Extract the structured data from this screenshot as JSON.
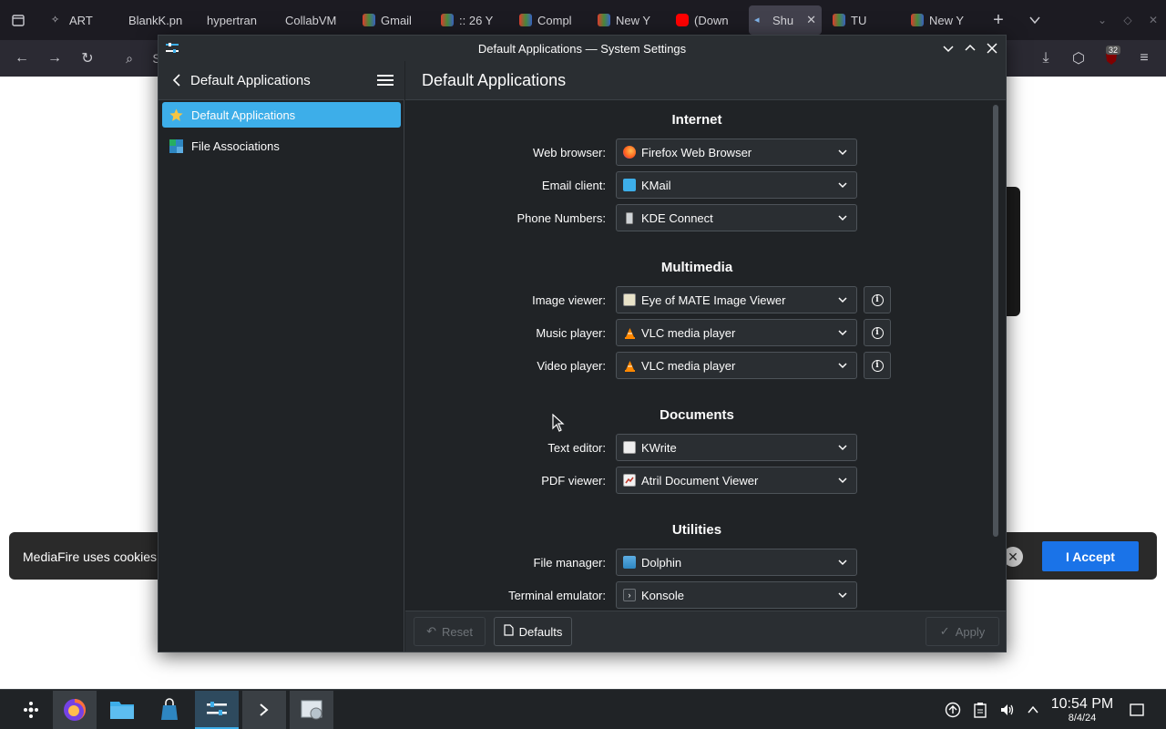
{
  "browser": {
    "tabs": [
      {
        "label": "ART"
      },
      {
        "label": "BlankK.pn"
      },
      {
        "label": "hypertran"
      },
      {
        "label": "CollabVM"
      },
      {
        "label": "Gmail"
      },
      {
        "label": ":: 26 Y"
      },
      {
        "label": "Compl"
      },
      {
        "label": "New Y"
      },
      {
        "label": "(Down"
      },
      {
        "label": "Shu"
      },
      {
        "label": "TU"
      },
      {
        "label": "New Y"
      }
    ],
    "address_fragment": "S",
    "badge_count": "32"
  },
  "cookie_banner": {
    "text": "MediaFire uses cookies t",
    "accept_label": "I Accept"
  },
  "window": {
    "title": "Default Applications — System Settings"
  },
  "sidebar": {
    "title": "Default Applications",
    "items": [
      {
        "label": "Default Applications",
        "icon": "star-icon",
        "selected": true
      },
      {
        "label": "File Associations",
        "icon": "file-associations-icon",
        "selected": false
      }
    ]
  },
  "content": {
    "title": "Default Applications",
    "sections": [
      {
        "title": "Internet",
        "rows": [
          {
            "label": "Web browser:",
            "value": "Firefox Web Browser",
            "icon": "firefox-icon"
          },
          {
            "label": "Email client:",
            "value": "KMail",
            "icon": "kmail-icon"
          },
          {
            "label": "Phone Numbers:",
            "value": "KDE Connect",
            "icon": "kdeconnect-icon"
          }
        ]
      },
      {
        "title": "Multimedia",
        "rows": [
          {
            "label": "Image viewer:",
            "value": "Eye of MATE Image Viewer",
            "icon": "image-viewer-icon"
          },
          {
            "label": "Music player:",
            "value": "VLC media player",
            "icon": "vlc-icon"
          },
          {
            "label": "Video player:",
            "value": "VLC media player",
            "icon": "vlc-icon"
          }
        ]
      },
      {
        "title": "Documents",
        "rows": [
          {
            "label": "Text editor:",
            "value": "KWrite",
            "icon": "kwrite-icon"
          },
          {
            "label": "PDF viewer:",
            "value": "Atril Document Viewer",
            "icon": "atril-icon"
          }
        ]
      },
      {
        "title": "Utilities",
        "rows": [
          {
            "label": "File manager:",
            "value": "Dolphin",
            "icon": "dolphin-icon"
          },
          {
            "label": "Terminal emulator:",
            "value": "Konsole",
            "icon": "konsole-icon"
          }
        ]
      }
    ]
  },
  "footer": {
    "reset_label": "Reset",
    "defaults_label": "Defaults",
    "apply_label": "Apply"
  },
  "taskbar": {
    "apps": [
      "app-launcher-icon",
      "firefox-icon",
      "file-manager-icon",
      "discover-icon",
      "system-settings-icon",
      "terminal-icon",
      "image-viewer-icon"
    ],
    "clock_time": "10:54 PM",
    "clock_date": "8/4/24"
  },
  "colors": {
    "accent": "#3daee9",
    "window_bg": "#202326",
    "header_bg": "#2a2e32",
    "cookie_accept": "#1a73e8"
  }
}
